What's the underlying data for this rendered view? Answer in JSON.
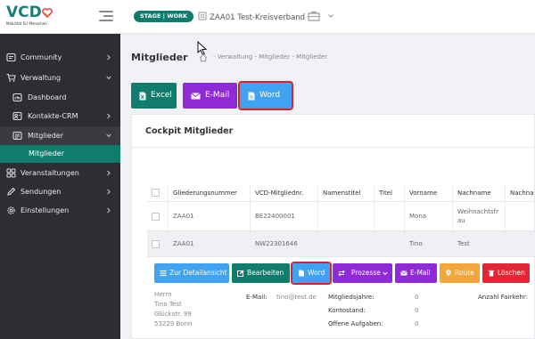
{
  "header": {
    "logo_text": "VCD",
    "logo_subtitle": "Mobilität für Menschen",
    "stage_badge": "STAGE | WORK",
    "organization": "ZAA01 Test-Kreisverband"
  },
  "sidebar": {
    "items": [
      {
        "label": "Community",
        "icon": "community-icon"
      },
      {
        "label": "Verwaltung",
        "icon": "cart-icon"
      },
      {
        "label": "Dashboard",
        "icon": "dashboard-icon"
      },
      {
        "label": "Kontakte-CRM",
        "icon": "contacts-icon"
      },
      {
        "label": "Mitglieder",
        "icon": "members-icon"
      },
      {
        "label": "Mitglieder"
      },
      {
        "label": "Veranstaltungen",
        "icon": "grid-icon"
      },
      {
        "label": "Sendungen",
        "icon": "pen-icon"
      },
      {
        "label": "Einstellungen",
        "icon": "gear-icon"
      }
    ]
  },
  "page": {
    "title": "Mitglieder",
    "breadcrumb": "- Verwaltung - Mitglieder - Mitglieder"
  },
  "export_buttons": {
    "excel": "Excel",
    "email": "E-Mail",
    "word": "Word"
  },
  "cockpit": {
    "title": "Cockpit Mitglieder",
    "columns": [
      "Gliederungsnummer",
      "VCD-Mitgliednr.",
      "Namenstitel",
      "Titel",
      "Vorname",
      "Nachname",
      "Nachna"
    ],
    "rows": [
      [
        "ZAA01",
        "BE22400001",
        "",
        "",
        "Mona",
        "Weihnachtsfrau",
        ""
      ],
      [
        "ZAA01",
        "NW22301646",
        "",
        "",
        "Tino",
        "Test",
        ""
      ]
    ],
    "actions": {
      "detail": "Zur Detailansicht",
      "edit": "Bearbeiten",
      "word": "Word",
      "processes": "Prozesse",
      "email": "E-Mail",
      "route": "Route",
      "delete": "Löschen"
    },
    "detail": {
      "address": [
        "Herrn",
        "Tino Test",
        "Glückstr. 99",
        "53229 Bonn"
      ],
      "email_label": "E-Mail:",
      "email_value": "tino@test.de",
      "years_label": "Mitgliedsjahre:",
      "years_value": "0",
      "account_label": "Kontostand:",
      "account_value": "0",
      "tasks_label": "Offene Aufgaben:",
      "tasks_value": "0",
      "fairkehr_label": "Anzahl Fairkehr:"
    }
  },
  "colors": {
    "teal": "#0f7c6e",
    "purple": "#8f2bd6",
    "blue": "#3fa2f3",
    "sidebar": "#2d2e33",
    "highlight": "#e01f2c",
    "orange": "#f3a73b",
    "red": "#e32636"
  }
}
